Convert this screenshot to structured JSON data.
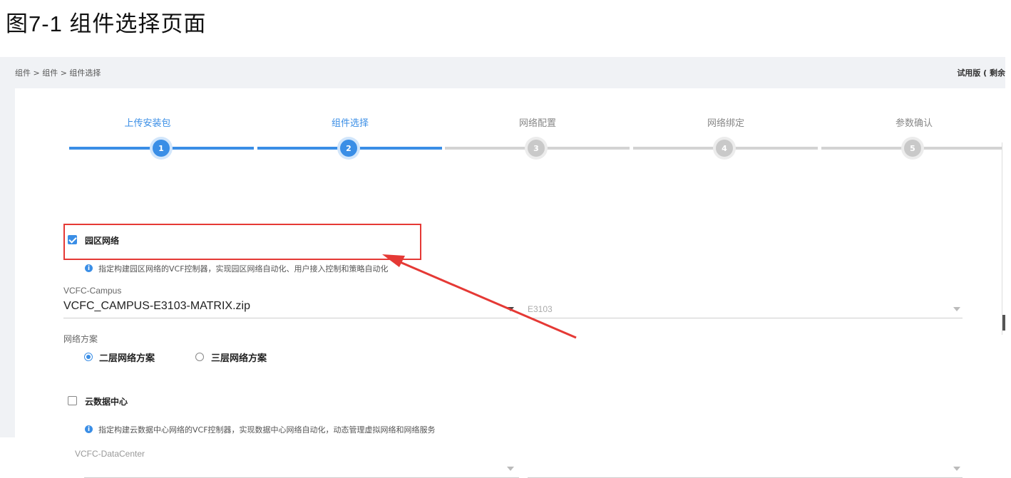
{
  "figure_title": "图7-1 组件选择页面",
  "breadcrumb": "组件 > 组件 > 组件选择",
  "trial_text": "试用版 ( 剩余",
  "steps": [
    {
      "label": "上传安装包",
      "number": "1",
      "state": "done"
    },
    {
      "label": "组件选择",
      "number": "2",
      "state": "current"
    },
    {
      "label": "网络配置",
      "number": "3",
      "state": "pending"
    },
    {
      "label": "网络绑定",
      "number": "4",
      "state": "pending"
    },
    {
      "label": "参数确认",
      "number": "5",
      "state": "pending"
    }
  ],
  "campus": {
    "checked": true,
    "title": "园区网络",
    "info": "指定构建园区网络的VCF控制器，实现园区网络自动化、用户接入控制和策略自动化",
    "field_label": "VCFC-Campus",
    "package_value": "VCFC_CAMPUS-E3103-MATRIX.zip",
    "version_value": "E3103",
    "scheme_label": "网络方案",
    "scheme_options": [
      {
        "label": "二层网络方案",
        "selected": true
      },
      {
        "label": "三层网络方案",
        "selected": false
      }
    ]
  },
  "datacenter": {
    "checked": false,
    "title": "云数据中心",
    "info": "指定构建云数据中心网络的VCF控制器，实现数据中心网络自动化，动态管理虚拟网络和网络服务",
    "field_label": "VCFC-DataCenter",
    "package_value": "",
    "version_value": ""
  },
  "icons": {
    "check": "checkmark-icon",
    "info": "info-icon",
    "caret": "chevron-down-icon",
    "annotation": "red-arrow-annotation"
  },
  "colors": {
    "accent": "#3a8ee6",
    "inactive": "#c9c9c9",
    "annotation": "#e53935"
  }
}
